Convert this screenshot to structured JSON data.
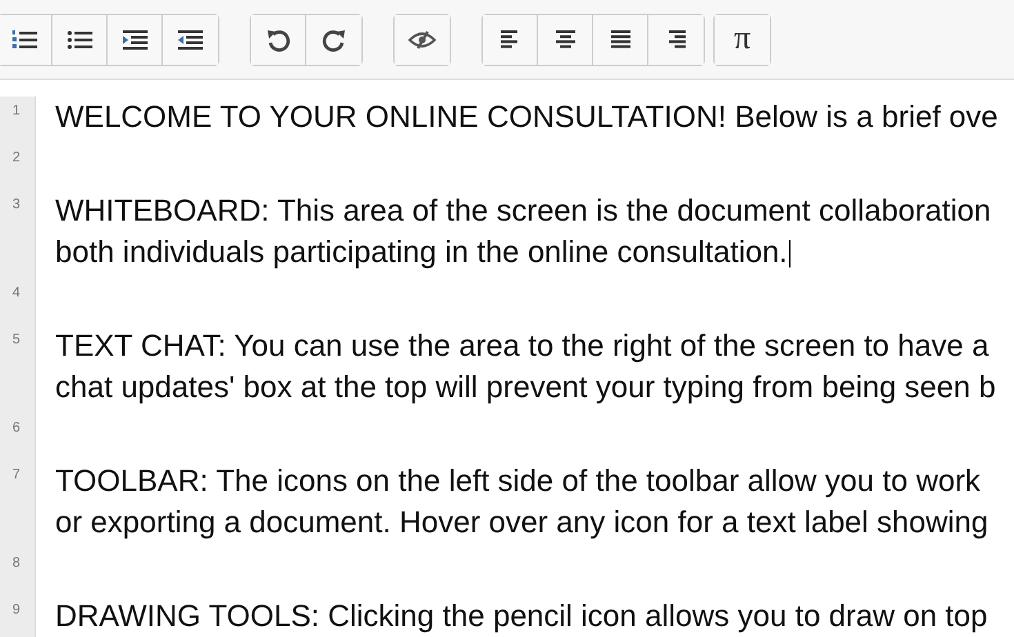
{
  "toolbar": {
    "math_button": {
      "label": "π"
    }
  },
  "editor": {
    "lines": [
      {
        "number": "1",
        "cursor": false,
        "rows": [
          "WELCOME TO YOUR ONLINE CONSULTATION! Below is a brief ove"
        ]
      },
      {
        "number": "2",
        "cursor": false
      },
      {
        "number": "3",
        "cursor": true,
        "rows": [
          "WHITEBOARD: This area of the screen is the document collaboration",
          "both individuals participating in the online consultation."
        ]
      },
      {
        "number": "4",
        "cursor": false
      },
      {
        "number": "5",
        "cursor": false,
        "rows": [
          "TEXT CHAT: You can use the area to the right of the screen to have a",
          "chat updates' box at the top will prevent your typing from being seen b"
        ]
      },
      {
        "number": "6",
        "cursor": false
      },
      {
        "number": "7",
        "cursor": false,
        "rows": [
          "TOOLBAR: The icons on the left side of the toolbar allow you to work",
          "or exporting a document. Hover over any icon for a text label showing"
        ]
      },
      {
        "number": "8",
        "cursor": false
      },
      {
        "number": "9",
        "cursor": false,
        "rows": [
          "DRAWING TOOLS: Clicking the pencil icon allows you to draw on top"
        ]
      }
    ]
  }
}
